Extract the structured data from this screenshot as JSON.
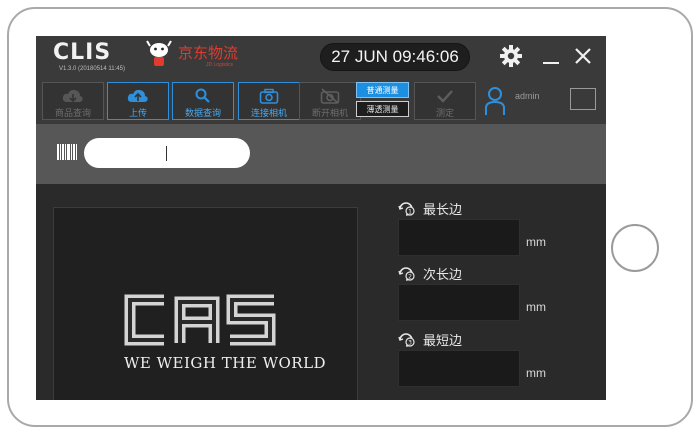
{
  "header": {
    "app_name": "CLIS",
    "version": "V1.3.0 (20180514 11:45)",
    "partner_name": "京东物流",
    "partner_sub": "JD Logistics",
    "clock": "27 JUN 09:46:06"
  },
  "toolbar": {
    "buttons": [
      {
        "label": "商品查询",
        "icon": "cloud-download-icon",
        "state": "disabled"
      },
      {
        "label": "上传",
        "icon": "cloud-upload-icon",
        "state": "active"
      },
      {
        "label": "数据查询",
        "icon": "search-icon",
        "state": "active"
      },
      {
        "label": "连接相机",
        "icon": "camera-icon",
        "state": "active"
      },
      {
        "label": "断开相机",
        "icon": "camera-off-icon",
        "state": "disabled"
      },
      {
        "label": "测定",
        "icon": "check-icon",
        "state": "disabled"
      }
    ],
    "mode_normal": "普通测量",
    "mode_thin": "薄透测量",
    "user": "admin"
  },
  "scan": {
    "value": ""
  },
  "logo": {
    "brand": "CAS",
    "tagline": "WE WEIGH THE WORLD"
  },
  "measurements": [
    {
      "label": "最长边",
      "value": "",
      "unit": "mm"
    },
    {
      "label": "次长边",
      "value": "",
      "unit": "mm"
    },
    {
      "label": "最短边",
      "value": "",
      "unit": "mm"
    }
  ],
  "colors": {
    "accent": "#2f8fdb",
    "brand_red": "#e23b2e",
    "background": "#2c2c2c"
  }
}
